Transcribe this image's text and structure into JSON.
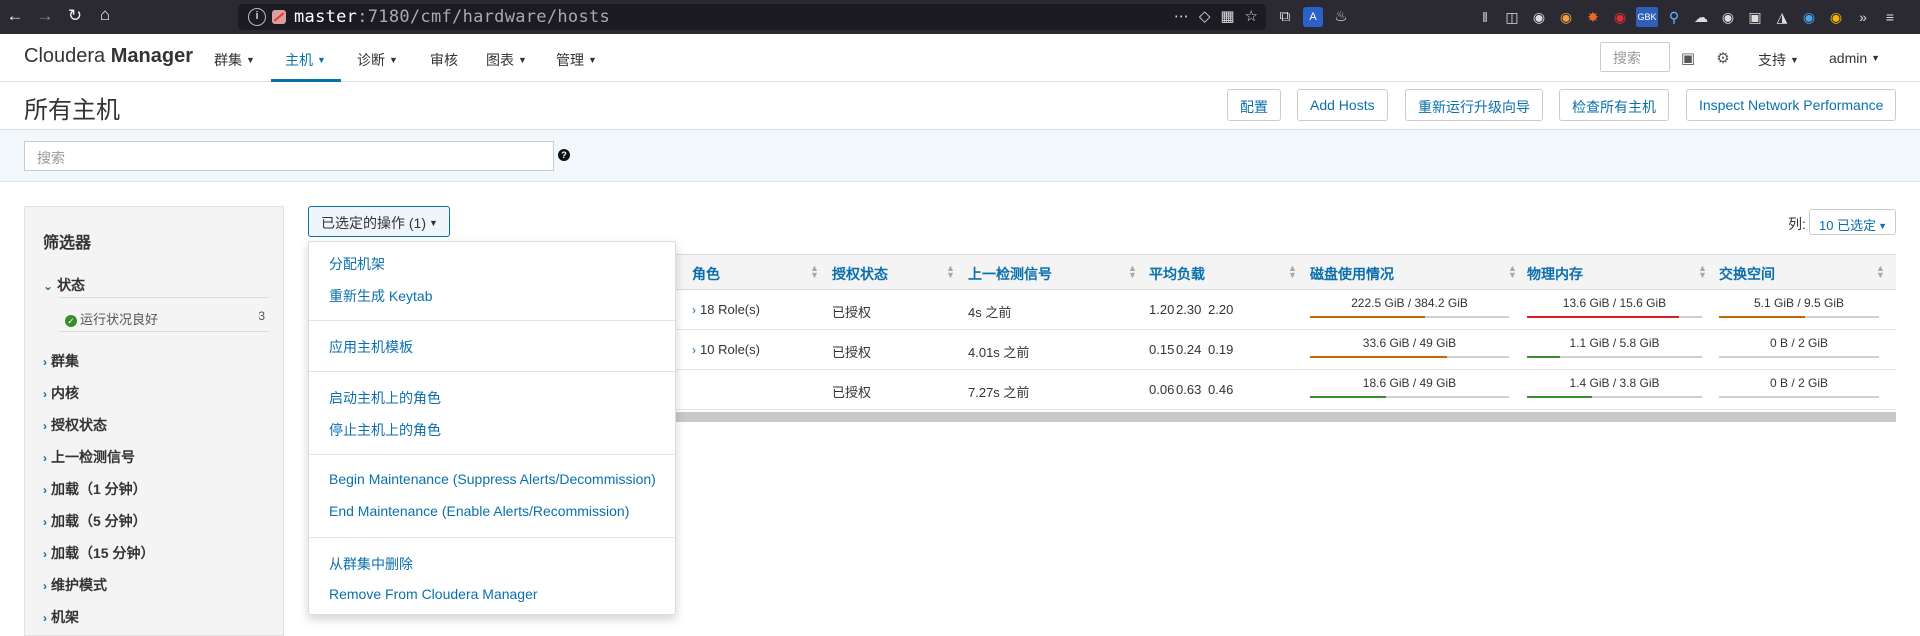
{
  "browser": {
    "url_host": "master",
    "url_rest": ":7180/cmf/hardware/hosts",
    "nav_icons": [
      "back-icon",
      "forward-icon",
      "reload-icon",
      "home-icon"
    ],
    "extension_badge": "GBK"
  },
  "navbar": {
    "brand_light": "Cloudera",
    "brand_bold": "Manager",
    "menu": [
      {
        "label": "群集",
        "dropdown": true
      },
      {
        "label": "主机",
        "dropdown": true,
        "active": true
      },
      {
        "label": "诊断",
        "dropdown": true
      },
      {
        "label": "审核",
        "dropdown": false
      },
      {
        "label": "图表",
        "dropdown": true
      },
      {
        "label": "管理",
        "dropdown": true
      }
    ],
    "search_placeholder": "搜索",
    "support_label": "支持",
    "user_label": "admin"
  },
  "page": {
    "title": "所有主机",
    "buttons": [
      "配置",
      "Add Hosts",
      "重新运行升级向导",
      "检查所有主机",
      "Inspect Network Performance"
    ],
    "search_placeholder": "搜索",
    "help_icon": "?"
  },
  "filters": {
    "title": "筛选器",
    "expanded_section": "状态",
    "status_item": {
      "label": "运行状况良好",
      "count": "3"
    },
    "sections": [
      "群集",
      "内核",
      "授权状态",
      "上一检测信号",
      "加载（1 分钟）",
      "加载（5 分钟）",
      "加载（15 分钟）",
      "维护模式",
      "机架"
    ]
  },
  "actions": {
    "button_label": "已选定的操作 (1)",
    "menu_groups": [
      [
        "分配机架",
        "重新生成 Keytab"
      ],
      [
        "应用主机模板"
      ],
      [
        "启动主机上的角色",
        "停止主机上的角色"
      ],
      [
        "Begin Maintenance (Suppress Alerts/Decommission)",
        "End Maintenance (Enable Alerts/Recommission)"
      ],
      [
        "从群集中删除",
        "Remove From Cloudera Manager"
      ]
    ]
  },
  "columns": {
    "label": "列:",
    "value": "10 已选定"
  },
  "table": {
    "headers": [
      "角色",
      "授权状态",
      "上一检测信号",
      "平均负载",
      "磁盘使用情况",
      "物理内存",
      "交换空间"
    ],
    "rows": [
      {
        "roles": "18 Role(s)",
        "auth": "已授权",
        "heartbeat": "4s 之前",
        "load": [
          "1.20",
          "2.30",
          "2.20"
        ],
        "disk": {
          "text": "222.5 GiB / 384.2 GiB",
          "ratio": 0.58,
          "color": "#c26a00"
        },
        "mem": {
          "text": "13.6 GiB / 15.6 GiB",
          "ratio": 0.87,
          "color": "#d62020"
        },
        "swap": {
          "text": "5.1 GiB / 9.5 GiB",
          "ratio": 0.54,
          "color": "#c26a00"
        }
      },
      {
        "roles": "10 Role(s)",
        "auth": "已授权",
        "heartbeat": "4.01s 之前",
        "load": [
          "0.15",
          "0.24",
          "0.19"
        ],
        "disk": {
          "text": "33.6 GiB / 49 GiB",
          "ratio": 0.69,
          "color": "#c26a00"
        },
        "mem": {
          "text": "1.1 GiB / 5.8 GiB",
          "ratio": 0.19,
          "color": "#3a8a2e"
        },
        "swap": {
          "text": "0 B / 2 GiB",
          "ratio": 0.0,
          "color": "#3a8a2e"
        }
      },
      {
        "roles": "",
        "auth": "已授权",
        "heartbeat": "7.27s 之前",
        "load": [
          "0.06",
          "0.63",
          "0.46"
        ],
        "disk": {
          "text": "18.6 GiB / 49 GiB",
          "ratio": 0.38,
          "color": "#3a8a2e"
        },
        "mem": {
          "text": "1.4 GiB / 3.8 GiB",
          "ratio": 0.37,
          "color": "#3a8a2e"
        },
        "swap": {
          "text": "0 B / 2 GiB",
          "ratio": 0.0,
          "color": "#3a8a2e"
        }
      }
    ]
  }
}
